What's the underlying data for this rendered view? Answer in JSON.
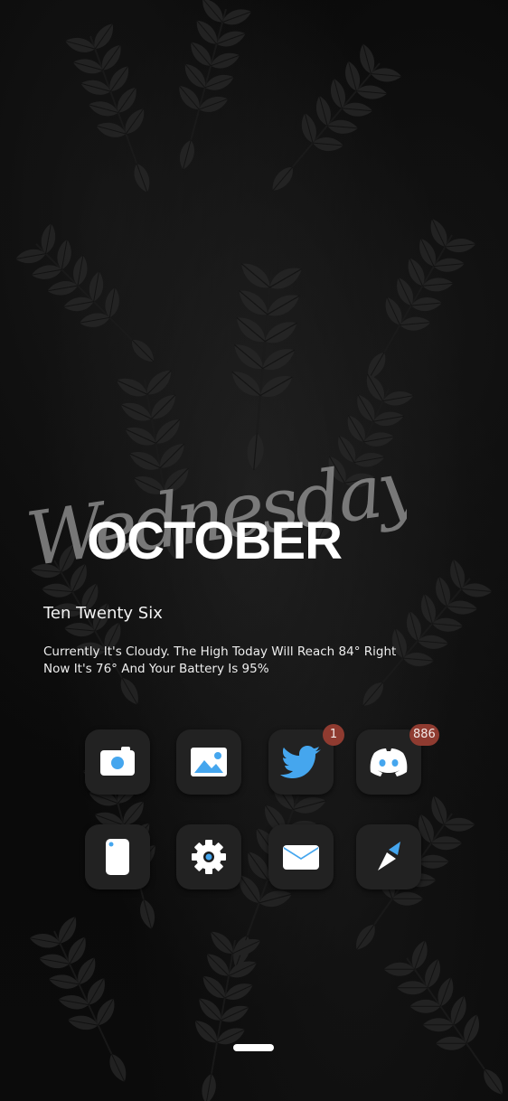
{
  "widget": {
    "day_script": "Wednesday",
    "month": "OCTOBER",
    "time_words": "Ten Twenty Six",
    "weather_line1": "Currently It's Cloudy. The High Today Will Reach 84° Right",
    "weather_line2": "Now It's 76° And Your Battery Is 95%"
  },
  "apps": [
    {
      "name": "Camera",
      "icon": "camera-icon",
      "badge": ""
    },
    {
      "name": "Gallery",
      "icon": "image-icon",
      "badge": ""
    },
    {
      "name": "Twitter",
      "icon": "twitter-bird-icon",
      "badge": "1"
    },
    {
      "name": "Discord",
      "icon": "discord-icon",
      "badge": "886"
    },
    {
      "name": "Phone",
      "icon": "phone-device-icon",
      "badge": ""
    },
    {
      "name": "Settings",
      "icon": "gear-icon",
      "badge": ""
    },
    {
      "name": "Mail",
      "icon": "envelope-icon",
      "badge": ""
    },
    {
      "name": "Notes",
      "icon": "pencil-icon",
      "badge": ""
    }
  ],
  "colors": {
    "icon_tile": "#222222",
    "accent_blue": "#45a6ee",
    "badge_bg": "#8f3b30",
    "background": "#050505"
  }
}
